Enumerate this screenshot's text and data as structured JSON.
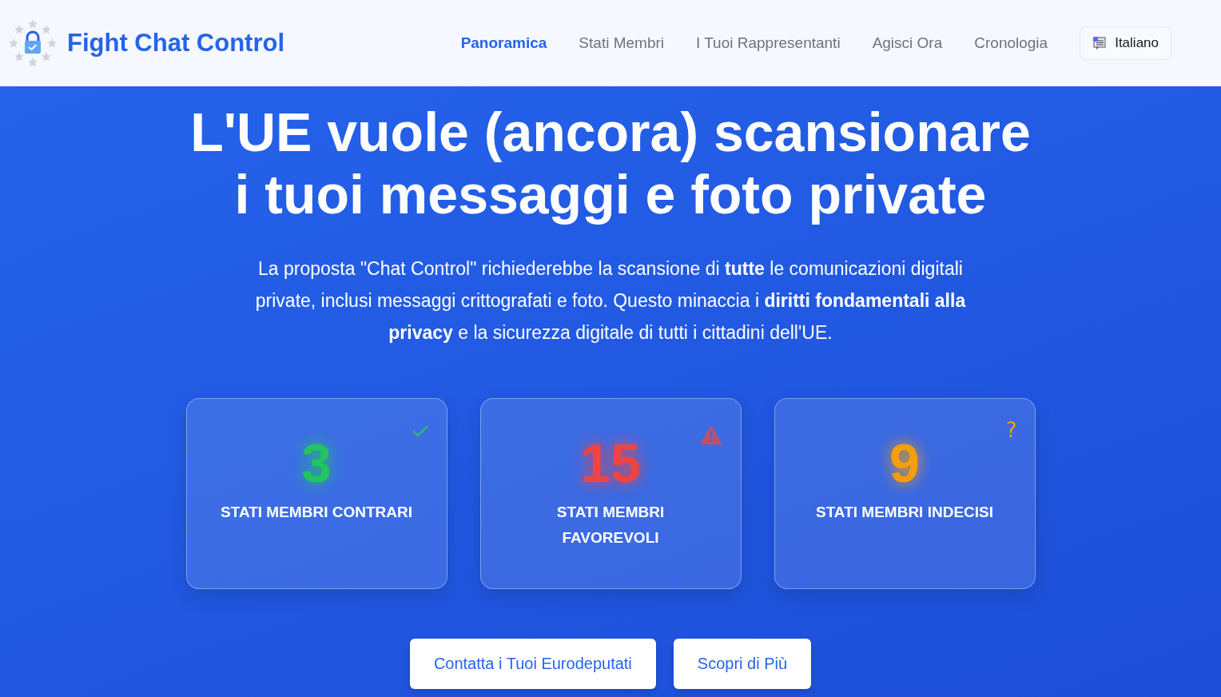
{
  "header": {
    "brand": "Fight Chat Control",
    "nav": [
      {
        "label": "Panoramica",
        "selected": true
      },
      {
        "label": "Stati Membri",
        "selected": false
      },
      {
        "label": "I Tuoi Rappresentanti",
        "selected": false
      },
      {
        "label": "Agisci Ora",
        "selected": false
      },
      {
        "label": "Cronologia",
        "selected": false
      }
    ],
    "language": "Italiano"
  },
  "hero": {
    "title_lines": [
      "L'UE vuole (ancora) scansionare",
      "i tuoi messaggi e foto private"
    ],
    "intro": "La proposta \"Chat Control\" richiederebbe la scansione di **tutte** le comunicazioni digitali private, inclusi messaggi crittografati e foto. Questo minaccia i **diritti fondamentali alla privacy** e la sicurezza digitale di tutti i cittadini dell'UE.",
    "stats": [
      {
        "kind": "against",
        "number": "3",
        "label": "STATI MEMBRI CONTRARI"
      },
      {
        "kind": "for",
        "number": "15",
        "label": "STATI MEMBRI FAVOREVOLI"
      },
      {
        "kind": "undecided",
        "number": "9",
        "label": "STATI MEMBRI INDECISI",
        "icon": "?"
      }
    ],
    "buttons": [
      "Contatta i Tuoi Eurodeputati",
      "Scopri di Più"
    ]
  }
}
